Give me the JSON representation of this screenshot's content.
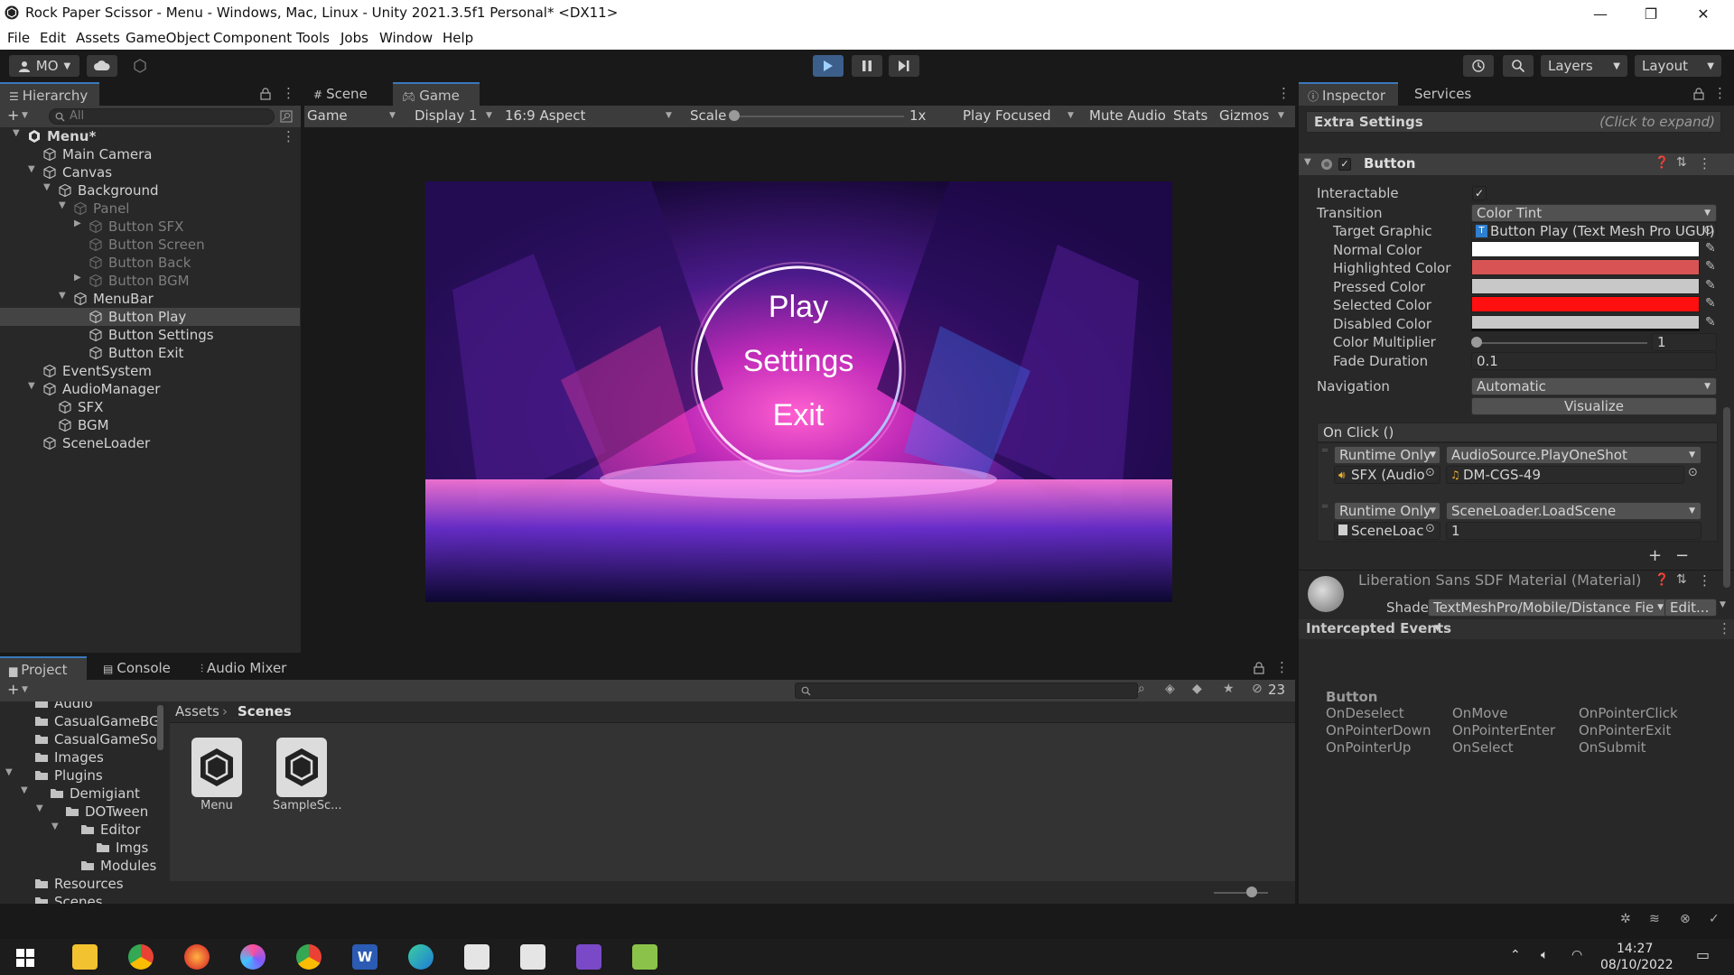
{
  "window": {
    "title": "Rock Paper Scissor - Menu - Windows, Mac, Linux - Unity 2021.3.5f1 Personal* <DX11>",
    "minimize": "—",
    "maximize": "❐",
    "close": "✕"
  },
  "menu": [
    "File",
    "Edit",
    "Assets",
    "GameObject",
    "Component",
    "Tools",
    "Jobs",
    "Window",
    "Help"
  ],
  "toolbar": {
    "account": "MO",
    "layers": "Layers",
    "layout": "Layout"
  },
  "hierarchy": {
    "tab": "Hierarchy",
    "search_placeholder": "All",
    "items": [
      {
        "label": "Menu*",
        "depth": 0,
        "arrow": "▼",
        "kind": "scene",
        "dim": false,
        "selected": false
      },
      {
        "label": "Main Camera",
        "depth": 1,
        "arrow": "",
        "kind": "obj",
        "dim": false,
        "selected": false
      },
      {
        "label": "Canvas",
        "depth": 1,
        "arrow": "▼",
        "kind": "obj",
        "dim": false,
        "selected": false
      },
      {
        "label": "Background",
        "depth": 2,
        "arrow": "▼",
        "kind": "obj",
        "dim": false,
        "selected": false
      },
      {
        "label": "Panel",
        "depth": 3,
        "arrow": "▼",
        "kind": "obj",
        "dim": true,
        "selected": false
      },
      {
        "label": "Button SFX",
        "depth": 4,
        "arrow": "▶",
        "kind": "obj",
        "dim": true,
        "selected": false
      },
      {
        "label": "Button Screen",
        "depth": 4,
        "arrow": "",
        "kind": "obj",
        "dim": true,
        "selected": false
      },
      {
        "label": "Button Back",
        "depth": 4,
        "arrow": "",
        "kind": "obj",
        "dim": true,
        "selected": false
      },
      {
        "label": "Button BGM",
        "depth": 4,
        "arrow": "▶",
        "kind": "obj",
        "dim": true,
        "selected": false
      },
      {
        "label": "MenuBar",
        "depth": 3,
        "arrow": "▼",
        "kind": "obj",
        "dim": false,
        "selected": false
      },
      {
        "label": "Button Play",
        "depth": 4,
        "arrow": "",
        "kind": "obj",
        "dim": false,
        "selected": true
      },
      {
        "label": "Button Settings",
        "depth": 4,
        "arrow": "",
        "kind": "obj",
        "dim": false,
        "selected": false
      },
      {
        "label": "Button Exit",
        "depth": 4,
        "arrow": "",
        "kind": "obj",
        "dim": false,
        "selected": false
      },
      {
        "label": "EventSystem",
        "depth": 1,
        "arrow": "",
        "kind": "obj",
        "dim": false,
        "selected": false
      },
      {
        "label": "AudioManager",
        "depth": 1,
        "arrow": "▼",
        "kind": "obj",
        "dim": false,
        "selected": false
      },
      {
        "label": "SFX",
        "depth": 2,
        "arrow": "",
        "kind": "obj",
        "dim": false,
        "selected": false
      },
      {
        "label": "BGM",
        "depth": 2,
        "arrow": "",
        "kind": "obj",
        "dim": false,
        "selected": false
      },
      {
        "label": "SceneLoader",
        "depth": 1,
        "arrow": "",
        "kind": "obj",
        "dim": false,
        "selected": false
      }
    ]
  },
  "scene_tabs": {
    "scene": "Scene",
    "game": "Game"
  },
  "game_bar": {
    "mode": "Game",
    "display": "Display 1",
    "aspect": "16:9 Aspect",
    "scale_label": "Scale",
    "scale_value": "1x",
    "scale_level": 0,
    "play_focused": "Play Focused",
    "mute": "Mute Audio",
    "stats": "Stats",
    "gizmos": "Gizmos"
  },
  "game_view": {
    "menu_items": [
      "Play",
      "Settings",
      "Exit"
    ]
  },
  "inspector": {
    "tab": "Inspector",
    "services_tab": "Services",
    "extra_settings": "Extra Settings",
    "click_expand": "(Click to expand)",
    "component": "Button",
    "props": {
      "interactable": "Interactable",
      "transition": "Transition",
      "transition_value": "Color Tint",
      "target_graphic": "Target Graphic",
      "target_graphic_value": "Button Play (Text Mesh Pro UGUI)",
      "normal": "Normal Color",
      "highlighted": "Highlighted Color",
      "pressed": "Pressed Color",
      "selected": "Selected Color",
      "disabled": "Disabled Color",
      "multiplier": "Color Multiplier",
      "multiplier_value": "1",
      "fade": "Fade Duration",
      "fade_value": "0.1",
      "navigation": "Navigation",
      "navigation_value": "Automatic",
      "visualize": "Visualize"
    },
    "colors": {
      "normal": "#ffffff",
      "highlighted": "#d85454",
      "pressed": "#c8c8c8",
      "selected": "#ff1010",
      "disabled": "#c8c8c8"
    },
    "on_click": {
      "title": "On Click ()",
      "entries": [
        {
          "runtime": "Runtime Only",
          "func": "AudioSource.PlayOneShot",
          "obj": "SFX (Audio",
          "arg": "DM-CGS-49"
        },
        {
          "runtime": "Runtime Only",
          "func": "SceneLoader.LoadScene",
          "obj": "SceneLoac",
          "arg": "1"
        }
      ],
      "add": "+",
      "remove": "−"
    },
    "material": {
      "name": "Liberation Sans SDF Material (Material)",
      "shader_label": "Shader",
      "shader_value": "TextMeshPro/Mobile/Distance Fie",
      "edit": "Edit..."
    },
    "intercepted": {
      "title": "Intercepted Events",
      "component": "Button",
      "events": [
        "OnDeselect",
        "OnMove",
        "OnPointerClick",
        "OnPointerDown",
        "OnPointerEnter",
        "OnPointerExit",
        "OnPointerUp",
        "OnSelect",
        "OnSubmit"
      ]
    }
  },
  "project": {
    "tabs": [
      "Project",
      "Console",
      "Audio Mixer"
    ],
    "folders": [
      {
        "label": "Audio",
        "depth": 1,
        "arrow": ""
      },
      {
        "label": "CasualGameBG",
        "depth": 1,
        "arrow": ""
      },
      {
        "label": "CasualGameSo",
        "depth": 1,
        "arrow": ""
      },
      {
        "label": "Images",
        "depth": 1,
        "arrow": ""
      },
      {
        "label": "Plugins",
        "depth": 1,
        "arrow": "▼"
      },
      {
        "label": "Demigiant",
        "depth": 2,
        "arrow": "▼"
      },
      {
        "label": "DOTween",
        "depth": 3,
        "arrow": "▼"
      },
      {
        "label": "Editor",
        "depth": 4,
        "arrow": "▼"
      },
      {
        "label": "Imgs",
        "depth": 5,
        "arrow": ""
      },
      {
        "label": "Modules",
        "depth": 4,
        "arrow": ""
      },
      {
        "label": "Resources",
        "depth": 1,
        "arrow": ""
      },
      {
        "label": "Scenes",
        "depth": 1,
        "arrow": ""
      }
    ],
    "breadcrumb": [
      "Assets",
      "Scenes"
    ],
    "assets": [
      "Menu",
      "SampleSc..."
    ],
    "hidden_count": "23"
  },
  "taskbar": {
    "time": "14:27",
    "date": "08/10/2022"
  }
}
